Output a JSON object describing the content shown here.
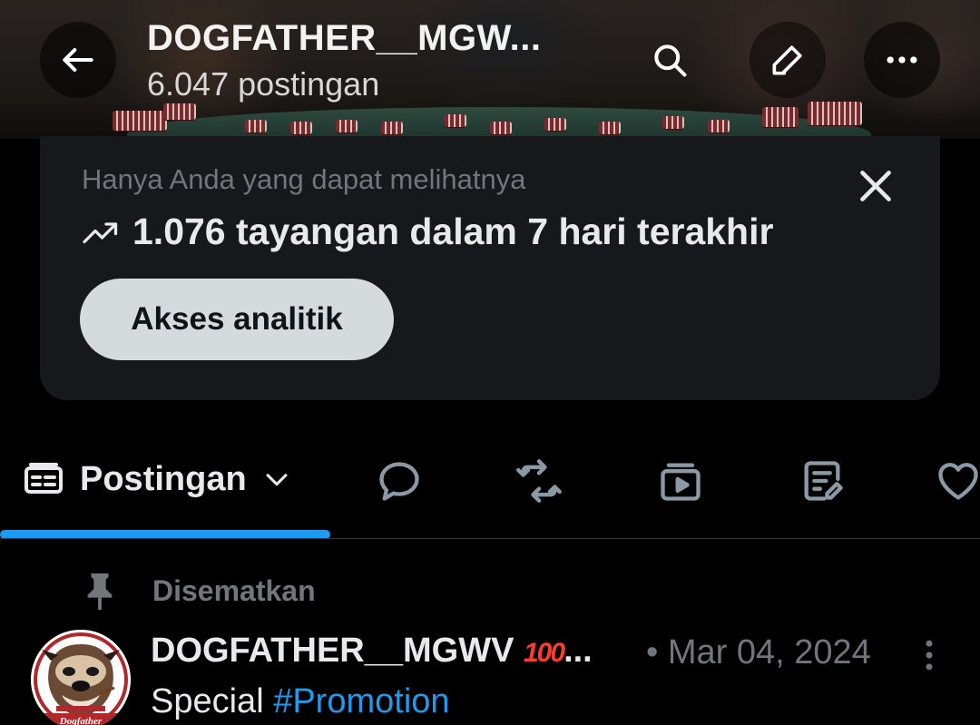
{
  "header": {
    "name": "DOGFATHER__MGW...",
    "post_count": "6.047 postingan"
  },
  "analytics_card": {
    "note": "Hanya Anda yang dapat melihatnya",
    "stat": "1.076 tayangan dalam 7 hari terakhir",
    "button_label": "Akses analitik"
  },
  "tabs": {
    "active_label": "Postingan",
    "icons": [
      "reply-icon",
      "repost-icon",
      "video-icon",
      "article-icon",
      "heart-icon"
    ]
  },
  "pinned_post": {
    "pinned_label": "Disematkan",
    "author": "DOGFATHER__MGWV",
    "emoji": "100",
    "ellipsis": "...",
    "date": "• Mar 04, 2024",
    "text_plain": "Special ",
    "hashtag": "#Promotion",
    "avatar_caption": "Dogfather"
  },
  "colors": {
    "accent": "#1d9bf0",
    "card_bg": "#16181c",
    "muted_text": "#71767b",
    "button_bg": "#d5dbdc"
  }
}
